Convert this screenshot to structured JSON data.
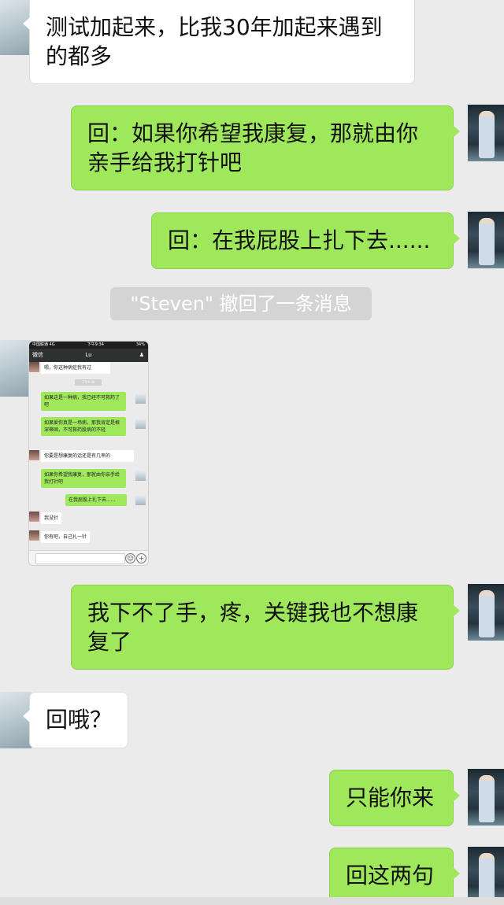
{
  "messages": {
    "m1": "测试加起来，比我30年加起来遇到的都多",
    "m2": "回：如果你希望我康复，那就由你亲手给我打针吧",
    "m3": "回：在我屁股上扎下去......",
    "recall": "\"Steven\" 撤回了一条消息",
    "m5": "我下不了手，疼，关键我也不想康复了",
    "m6": "回哦？",
    "m7": "只能你来",
    "m8": "回这两句"
  },
  "screenshot": {
    "carrier": "中国联通  4G",
    "time": "下午9:34",
    "battery": "34%",
    "back_label": "微信",
    "contact": "Lu",
    "top_cut": "嗯，你这种病症我有过",
    "timestamp": "下午9:36",
    "bubbles": [
      "如果这是一种病，我已经不可救药了吧",
      "如果爱你真是一场病，那我肯定是根深蒂固，不可救药股病的不轻",
      "你要是想康复的话还是有几率的",
      "如果你希望我康复，那就由你亲手给我打针吧",
      "在我屁股上扎下去......",
      "我没针",
      "你有吧，自己扎一针"
    ]
  },
  "colors": {
    "background": "#ebebeb",
    "outgoing": "#9fe85c",
    "incoming": "#ffffff",
    "recall_pill": "#d4d4d4"
  }
}
